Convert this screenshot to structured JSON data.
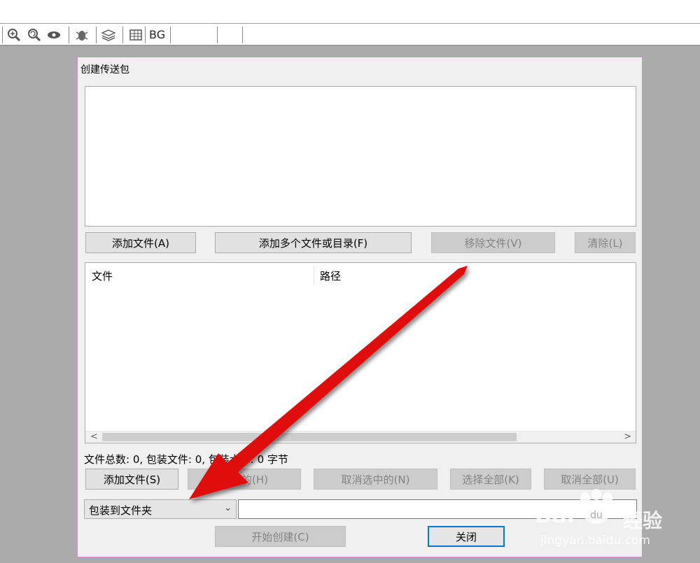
{
  "toolbar": {
    "bg_label": "BG",
    "icons": [
      "zoom-in-icon",
      "zoom-reset-icon",
      "eye-icon",
      "bug-icon",
      "layers-icon",
      "grid-icon"
    ]
  },
  "dialog": {
    "title": "创建传送包",
    "buttons_row1": {
      "add_file": "添加文件(A)",
      "add_multiple": "添加多个文件或目录(F)",
      "remove_file": "移除文件(V)",
      "clear": "清除(L)"
    },
    "list": {
      "columns": [
        "文件",
        "路径"
      ],
      "rows": []
    },
    "status": "文件总数: 0, 包装文件: 0, 包装大小: 0 字节",
    "buttons_row2": {
      "add_file": "添加文件(S)",
      "selected": "选中的(H)",
      "deselect": "取消选中的(N)",
      "select_all": "选择全部(K)",
      "deselect_all": "取消全部(U)"
    },
    "package_mode": {
      "selected": "包装到文件夹"
    },
    "path_value": "",
    "start_create": "开始创建(C)",
    "close": "关闭"
  },
  "watermark": {
    "brand": "Bai",
    "brand2": "du",
    "cn": "经验",
    "url": "jingyan.baidu.com"
  },
  "colors": {
    "accent": "#0078d7",
    "arrow": "#e01010"
  }
}
